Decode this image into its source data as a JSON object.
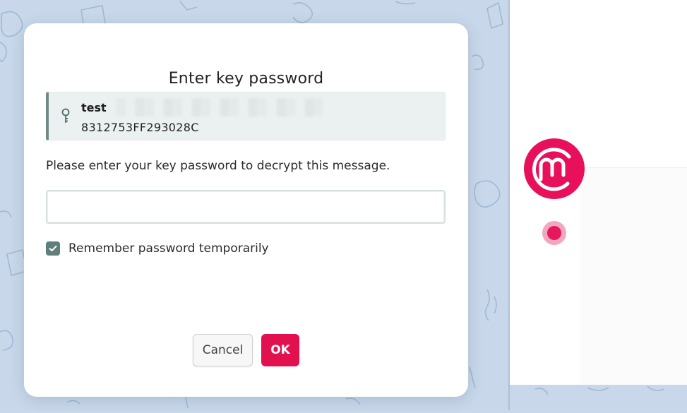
{
  "dialog": {
    "title": "Enter key password",
    "key": {
      "name": "test",
      "fingerprint": "8312753FF293028C",
      "icon": "key-icon"
    },
    "prompt": "Please enter your key password to decrypt this message.",
    "password_field": {
      "value": "",
      "placeholder": ""
    },
    "remember": {
      "label": "Remember password temporarily",
      "checked": true
    },
    "buttons": {
      "cancel": "Cancel",
      "ok": "OK"
    }
  },
  "colors": {
    "accent": "#e3104f",
    "key_card_bg": "#eaf1f0",
    "key_card_border": "#6e8a88",
    "checkbox": "#5f7f7c",
    "background": "#c8d8ea"
  },
  "icons": [
    "key-icon",
    "check-icon",
    "brand-logo-icon"
  ]
}
